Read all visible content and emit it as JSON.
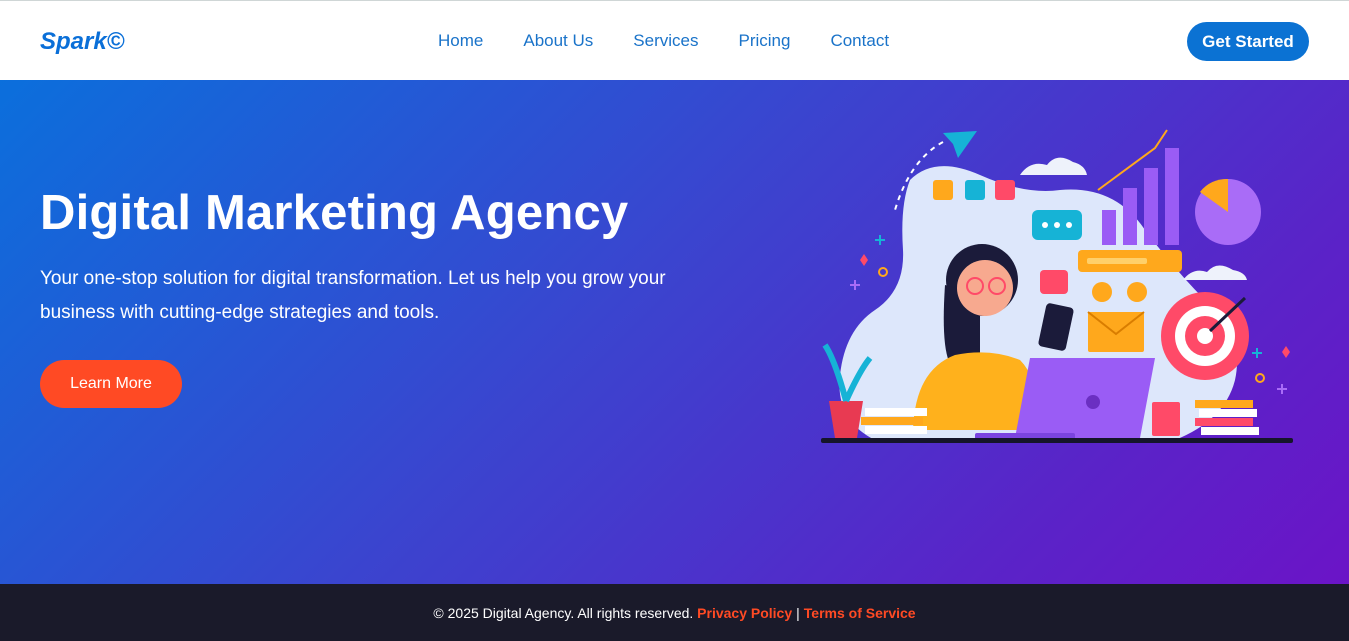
{
  "header": {
    "logo": "Spark©",
    "nav": [
      "Home",
      "About Us",
      "Services",
      "Pricing",
      "Contact"
    ],
    "cta_label": "Get Started"
  },
  "hero": {
    "title": "Digital Marketing Agency",
    "subtitle": "Your one-stop solution for digital transformation. Let us help you grow your business with cutting-edge strategies and tools.",
    "button_label": "Learn More"
  },
  "footer": {
    "copyright": "© 2025 Digital Agency. All rights reserved.",
    "privacy_label": "Privacy Policy",
    "separator": "|",
    "terms_label": "Terms of Service"
  },
  "colors": {
    "brand_blue": "#0b72d3",
    "accent_orange": "#ff4a24",
    "hero_gradient_start": "#0b6fdc",
    "hero_gradient_end": "#6b14c7",
    "footer_bg": "#1a1a2a"
  },
  "icons": [
    "paper-plane-icon",
    "phone-icon",
    "at-sign-icon",
    "dollar-icon",
    "chat-icon",
    "heart-icon",
    "envelope-icon",
    "target-icon",
    "smile-icon",
    "frown-icon",
    "pie-chart-icon",
    "bar-chart-icon"
  ]
}
